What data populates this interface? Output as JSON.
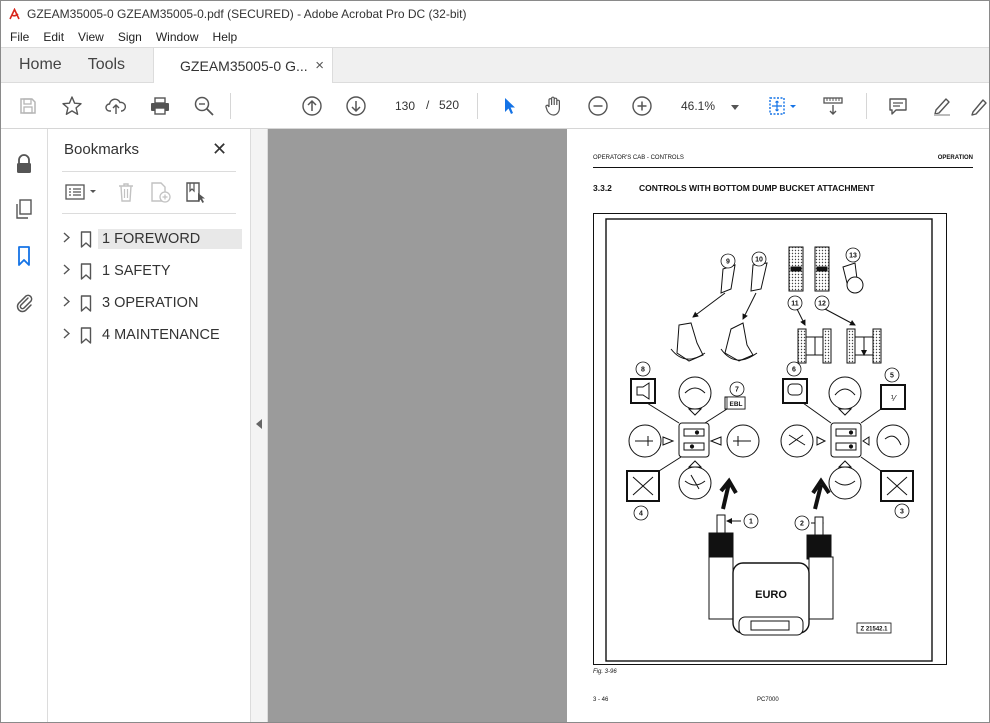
{
  "window": {
    "title": "GZEAM35005-0 GZEAM35005-0.pdf (SECURED) - Adobe Acrobat Pro DC (32-bit)",
    "accent": "#1473e6",
    "app_icon_color": "#d9261c"
  },
  "menu": [
    "File",
    "Edit",
    "View",
    "Sign",
    "Window",
    "Help"
  ],
  "tabs": {
    "home": "Home",
    "tools": "Tools",
    "document": "GZEAM35005-0 G...",
    "close_glyph": "×"
  },
  "toolbar": {
    "current_page": "130",
    "page_separator": "/",
    "total_pages": "520",
    "zoom": "46.1%",
    "icons": [
      "save-icon",
      "star-icon",
      "upload-icon",
      "print-icon",
      "search-zoom-icon",
      "prev-page-icon",
      "next-page-icon",
      "select-cursor-icon",
      "hand-icon",
      "zoom-out-icon",
      "zoom-in-icon",
      "fit-page-icon",
      "scroll-mode-icon",
      "comment-icon",
      "highlight-icon",
      "draw-icon"
    ]
  },
  "left_rail": {
    "icons": [
      "lock-icon",
      "pages-icon",
      "bookmark-icon",
      "attachment-icon"
    ]
  },
  "bookmarks_panel": {
    "title": "Bookmarks",
    "close_glyph": "✕",
    "items": [
      {
        "label": "1 FOREWORD",
        "selected": true
      },
      {
        "label": "1 SAFETY",
        "selected": false
      },
      {
        "label": "3 OPERATION",
        "selected": false
      },
      {
        "label": "4 MAINTENANCE",
        "selected": false
      }
    ]
  },
  "pdf_page": {
    "header_left": "OPERATOR'S CAB - CONTROLS",
    "header_right": "OPERATION",
    "section_number": "3.3.2",
    "section_title": "CONTROLS WITH BOTTOM DUMP BUCKET ATTACHMENT",
    "figure": {
      "euro_label": "EURO",
      "ebl_label": "EBL",
      "ref_label": "Z 21542.1",
      "callouts": [
        "1",
        "2",
        "3",
        "4",
        "5",
        "6",
        "7",
        "8",
        "9",
        "10",
        "11",
        "12",
        "13"
      ]
    },
    "figure_caption": "Fig. 3-96",
    "footer_left": "3 - 46",
    "footer_center": "PC7000"
  }
}
